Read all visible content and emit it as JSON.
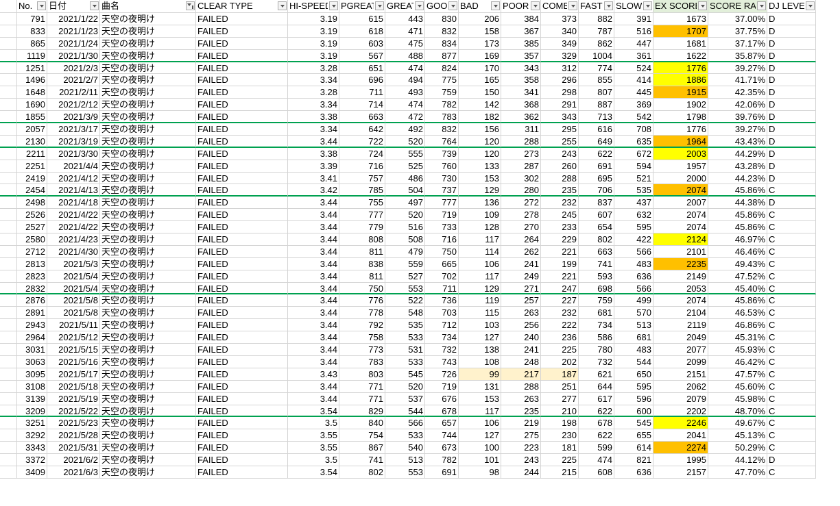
{
  "headers": [
    {
      "label": "",
      "filter": false
    },
    {
      "label": "No.",
      "filter": true
    },
    {
      "label": "日付",
      "filter": true
    },
    {
      "label": "曲名",
      "filter": true,
      "filtered": true
    },
    {
      "label": "CLEAR TYPE",
      "filter": true
    },
    {
      "label": "HI-SPEED",
      "filter": true
    },
    {
      "label": "PGREAT",
      "filter": true
    },
    {
      "label": "GREAT",
      "filter": true
    },
    {
      "label": "GOOD",
      "filter": true
    },
    {
      "label": "BAD",
      "filter": true
    },
    {
      "label": "POOR",
      "filter": true
    },
    {
      "label": "COMBO",
      "filter": true
    },
    {
      "label": "FAST",
      "filter": true
    },
    {
      "label": "SLOW",
      "filter": true
    },
    {
      "label": "EX SCORE",
      "filter": true,
      "green": true
    },
    {
      "label": "SCORE RATE",
      "filter": true,
      "green": true
    },
    {
      "label": "DJ LEVEL",
      "filter": true
    }
  ],
  "rows": [
    {
      "no": "791",
      "date": "2021/1/22",
      "song": "天空の夜明け",
      "clear": "FAILED",
      "hs": "3.19",
      "pg": "615",
      "gr": "443",
      "gd": "830",
      "bd": "206",
      "pr": "384",
      "cb": "373",
      "fs": "882",
      "sl": "391",
      "ex": "1673",
      "rate": "37.00%",
      "dj": "D"
    },
    {
      "no": "833",
      "date": "2021/1/23",
      "song": "天空の夜明け",
      "clear": "FAILED",
      "hs": "3.19",
      "pg": "618",
      "gr": "471",
      "gd": "832",
      "bd": "158",
      "pr": "367",
      "cb": "340",
      "fs": "787",
      "sl": "516",
      "ex": "1707",
      "rate": "37.75%",
      "dj": "D",
      "exhl": "o"
    },
    {
      "no": "865",
      "date": "2021/1/24",
      "song": "天空の夜明け",
      "clear": "FAILED",
      "hs": "3.19",
      "pg": "603",
      "gr": "475",
      "gd": "834",
      "bd": "173",
      "pr": "385",
      "cb": "349",
      "fs": "862",
      "sl": "447",
      "ex": "1681",
      "rate": "37.17%",
      "dj": "D"
    },
    {
      "no": "1119",
      "date": "2021/1/30",
      "song": "天空の夜明け",
      "clear": "FAILED",
      "hs": "3.19",
      "pg": "567",
      "gr": "488",
      "gd": "877",
      "bd": "169",
      "pr": "357",
      "cb": "329",
      "fs": "1004",
      "sl": "361",
      "ex": "1622",
      "rate": "35.87%",
      "dj": "D",
      "sep": true
    },
    {
      "no": "1251",
      "date": "2021/2/3",
      "song": "天空の夜明け",
      "clear": "FAILED",
      "hs": "3.28",
      "pg": "651",
      "gr": "474",
      "gd": "824",
      "bd": "170",
      "pr": "343",
      "cb": "312",
      "fs": "774",
      "sl": "524",
      "ex": "1776",
      "rate": "39.27%",
      "dj": "D",
      "exhl": "y"
    },
    {
      "no": "1496",
      "date": "2021/2/7",
      "song": "天空の夜明け",
      "clear": "FAILED",
      "hs": "3.34",
      "pg": "696",
      "gr": "494",
      "gd": "775",
      "bd": "165",
      "pr": "358",
      "cb": "296",
      "fs": "855",
      "sl": "414",
      "ex": "1886",
      "rate": "41.71%",
      "dj": "D",
      "exhl": "y"
    },
    {
      "no": "1648",
      "date": "2021/2/11",
      "song": "天空の夜明け",
      "clear": "FAILED",
      "hs": "3.28",
      "pg": "711",
      "gr": "493",
      "gd": "759",
      "bd": "150",
      "pr": "341",
      "cb": "298",
      "fs": "807",
      "sl": "445",
      "ex": "1915",
      "rate": "42.35%",
      "dj": "D",
      "exhl": "o"
    },
    {
      "no": "1690",
      "date": "2021/2/12",
      "song": "天空の夜明け",
      "clear": "FAILED",
      "hs": "3.34",
      "pg": "714",
      "gr": "474",
      "gd": "782",
      "bd": "142",
      "pr": "368",
      "cb": "291",
      "fs": "887",
      "sl": "369",
      "ex": "1902",
      "rate": "42.06%",
      "dj": "D"
    },
    {
      "no": "1855",
      "date": "2021/3/9",
      "song": "天空の夜明け",
      "clear": "FAILED",
      "hs": "3.38",
      "pg": "663",
      "gr": "472",
      "gd": "783",
      "bd": "182",
      "pr": "362",
      "cb": "343",
      "fs": "713",
      "sl": "542",
      "ex": "1798",
      "rate": "39.76%",
      "dj": "D",
      "sep": true
    },
    {
      "no": "2057",
      "date": "2021/3/17",
      "song": "天空の夜明け",
      "clear": "FAILED",
      "hs": "3.34",
      "pg": "642",
      "gr": "492",
      "gd": "832",
      "bd": "156",
      "pr": "311",
      "cb": "295",
      "fs": "616",
      "sl": "708",
      "ex": "1776",
      "rate": "39.27%",
      "dj": "D"
    },
    {
      "no": "2130",
      "date": "2021/3/19",
      "song": "天空の夜明け",
      "clear": "FAILED",
      "hs": "3.44",
      "pg": "722",
      "gr": "520",
      "gd": "764",
      "bd": "120",
      "pr": "288",
      "cb": "255",
      "fs": "649",
      "sl": "635",
      "ex": "1964",
      "rate": "43.43%",
      "dj": "D",
      "exhl": "o",
      "sep": true
    },
    {
      "no": "2211",
      "date": "2021/3/30",
      "song": "天空の夜明け",
      "clear": "FAILED",
      "hs": "3.38",
      "pg": "724",
      "gr": "555",
      "gd": "739",
      "bd": "120",
      "pr": "273",
      "cb": "243",
      "fs": "622",
      "sl": "672",
      "ex": "2003",
      "rate": "44.29%",
      "dj": "D",
      "exhl": "y"
    },
    {
      "no": "2251",
      "date": "2021/4/4",
      "song": "天空の夜明け",
      "clear": "FAILED",
      "hs": "3.39",
      "pg": "716",
      "gr": "525",
      "gd": "760",
      "bd": "133",
      "pr": "287",
      "cb": "260",
      "fs": "691",
      "sl": "594",
      "ex": "1957",
      "rate": "43.28%",
      "dj": "D"
    },
    {
      "no": "2419",
      "date": "2021/4/12",
      "song": "天空の夜明け",
      "clear": "FAILED",
      "hs": "3.41",
      "pg": "757",
      "gr": "486",
      "gd": "730",
      "bd": "153",
      "pr": "302",
      "cb": "288",
      "fs": "695",
      "sl": "521",
      "ex": "2000",
      "rate": "44.23%",
      "dj": "D"
    },
    {
      "no": "2454",
      "date": "2021/4/13",
      "song": "天空の夜明け",
      "clear": "FAILED",
      "hs": "3.42",
      "pg": "785",
      "gr": "504",
      "gd": "737",
      "bd": "129",
      "pr": "280",
      "cb": "235",
      "fs": "706",
      "sl": "535",
      "ex": "2074",
      "rate": "45.86%",
      "dj": "C",
      "exhl": "o",
      "sep": true
    },
    {
      "no": "2498",
      "date": "2021/4/18",
      "song": "天空の夜明け",
      "clear": "FAILED",
      "hs": "3.44",
      "pg": "755",
      "gr": "497",
      "gd": "777",
      "bd": "136",
      "pr": "272",
      "cb": "232",
      "fs": "837",
      "sl": "437",
      "ex": "2007",
      "rate": "44.38%",
      "dj": "D"
    },
    {
      "no": "2526",
      "date": "2021/4/22",
      "song": "天空の夜明け",
      "clear": "FAILED",
      "hs": "3.44",
      "pg": "777",
      "gr": "520",
      "gd": "719",
      "bd": "109",
      "pr": "278",
      "cb": "245",
      "fs": "607",
      "sl": "632",
      "ex": "2074",
      "rate": "45.86%",
      "dj": "C"
    },
    {
      "no": "2527",
      "date": "2021/4/22",
      "song": "天空の夜明け",
      "clear": "FAILED",
      "hs": "3.44",
      "pg": "779",
      "gr": "516",
      "gd": "733",
      "bd": "128",
      "pr": "270",
      "cb": "233",
      "fs": "654",
      "sl": "595",
      "ex": "2074",
      "rate": "45.86%",
      "dj": "C"
    },
    {
      "no": "2580",
      "date": "2021/4/23",
      "song": "天空の夜明け",
      "clear": "FAILED",
      "hs": "3.44",
      "pg": "808",
      "gr": "508",
      "gd": "716",
      "bd": "117",
      "pr": "264",
      "cb": "229",
      "fs": "802",
      "sl": "422",
      "ex": "2124",
      "rate": "46.97%",
      "dj": "C",
      "exhl": "y"
    },
    {
      "no": "2712",
      "date": "2021/4/30",
      "song": "天空の夜明け",
      "clear": "FAILED",
      "hs": "3.44",
      "pg": "811",
      "gr": "479",
      "gd": "750",
      "bd": "114",
      "pr": "262",
      "cb": "221",
      "fs": "663",
      "sl": "566",
      "ex": "2101",
      "rate": "46.46%",
      "dj": "C"
    },
    {
      "no": "2813",
      "date": "2021/5/3",
      "song": "天空の夜明け",
      "clear": "FAILED",
      "hs": "3.44",
      "pg": "838",
      "gr": "559",
      "gd": "665",
      "bd": "106",
      "pr": "241",
      "cb": "199",
      "fs": "741",
      "sl": "483",
      "ex": "2235",
      "rate": "49.43%",
      "dj": "C",
      "exhl": "o"
    },
    {
      "no": "2823",
      "date": "2021/5/4",
      "song": "天空の夜明け",
      "clear": "FAILED",
      "hs": "3.44",
      "pg": "811",
      "gr": "527",
      "gd": "702",
      "bd": "117",
      "pr": "249",
      "cb": "221",
      "fs": "593",
      "sl": "636",
      "ex": "2149",
      "rate": "47.52%",
      "dj": "C"
    },
    {
      "no": "2832",
      "date": "2021/5/4",
      "song": "天空の夜明け",
      "clear": "FAILED",
      "hs": "3.44",
      "pg": "750",
      "gr": "553",
      "gd": "711",
      "bd": "129",
      "pr": "271",
      "cb": "247",
      "fs": "698",
      "sl": "566",
      "ex": "2053",
      "rate": "45.40%",
      "dj": "C",
      "sep": true
    },
    {
      "no": "2876",
      "date": "2021/5/8",
      "song": "天空の夜明け",
      "clear": "FAILED",
      "hs": "3.44",
      "pg": "776",
      "gr": "522",
      "gd": "736",
      "bd": "119",
      "pr": "257",
      "cb": "227",
      "fs": "759",
      "sl": "499",
      "ex": "2074",
      "rate": "45.86%",
      "dj": "C"
    },
    {
      "no": "2891",
      "date": "2021/5/8",
      "song": "天空の夜明け",
      "clear": "FAILED",
      "hs": "3.44",
      "pg": "778",
      "gr": "548",
      "gd": "703",
      "bd": "115",
      "pr": "263",
      "cb": "232",
      "fs": "681",
      "sl": "570",
      "ex": "2104",
      "rate": "46.53%",
      "dj": "C"
    },
    {
      "no": "2943",
      "date": "2021/5/11",
      "song": "天空の夜明け",
      "clear": "FAILED",
      "hs": "3.44",
      "pg": "792",
      "gr": "535",
      "gd": "712",
      "bd": "103",
      "pr": "256",
      "cb": "222",
      "fs": "734",
      "sl": "513",
      "ex": "2119",
      "rate": "46.86%",
      "dj": "C"
    },
    {
      "no": "2964",
      "date": "2021/5/12",
      "song": "天空の夜明け",
      "clear": "FAILED",
      "hs": "3.44",
      "pg": "758",
      "gr": "533",
      "gd": "734",
      "bd": "127",
      "pr": "240",
      "cb": "236",
      "fs": "586",
      "sl": "681",
      "ex": "2049",
      "rate": "45.31%",
      "dj": "C"
    },
    {
      "no": "3031",
      "date": "2021/5/15",
      "song": "天空の夜明け",
      "clear": "FAILED",
      "hs": "3.44",
      "pg": "773",
      "gr": "531",
      "gd": "732",
      "bd": "138",
      "pr": "241",
      "cb": "225",
      "fs": "780",
      "sl": "483",
      "ex": "2077",
      "rate": "45.93%",
      "dj": "C"
    },
    {
      "no": "3063",
      "date": "2021/5/16",
      "song": "天空の夜明け",
      "clear": "FAILED",
      "hs": "3.44",
      "pg": "783",
      "gr": "533",
      "gd": "743",
      "bd": "108",
      "pr": "248",
      "cb": "202",
      "fs": "732",
      "sl": "544",
      "ex": "2099",
      "rate": "46.42%",
      "dj": "C"
    },
    {
      "no": "3095",
      "date": "2021/5/17",
      "song": "天空の夜明け",
      "clear": "FAILED",
      "hs": "3.43",
      "pg": "803",
      "gr": "545",
      "gd": "726",
      "bd": "99",
      "pr": "217",
      "cb": "187",
      "fs": "621",
      "sl": "650",
      "ex": "2151",
      "rate": "47.57%",
      "dj": "C",
      "missbest": true
    },
    {
      "no": "3108",
      "date": "2021/5/18",
      "song": "天空の夜明け",
      "clear": "FAILED",
      "hs": "3.44",
      "pg": "771",
      "gr": "520",
      "gd": "719",
      "bd": "131",
      "pr": "288",
      "cb": "251",
      "fs": "644",
      "sl": "595",
      "ex": "2062",
      "rate": "45.60%",
      "dj": "C"
    },
    {
      "no": "3139",
      "date": "2021/5/19",
      "song": "天空の夜明け",
      "clear": "FAILED",
      "hs": "3.44",
      "pg": "771",
      "gr": "537",
      "gd": "676",
      "bd": "153",
      "pr": "263",
      "cb": "277",
      "fs": "617",
      "sl": "596",
      "ex": "2079",
      "rate": "45.98%",
      "dj": "C"
    },
    {
      "no": "3209",
      "date": "2021/5/22",
      "song": "天空の夜明け",
      "clear": "FAILED",
      "hs": "3.54",
      "pg": "829",
      "gr": "544",
      "gd": "678",
      "bd": "117",
      "pr": "235",
      "cb": "210",
      "fs": "622",
      "sl": "600",
      "ex": "2202",
      "rate": "48.70%",
      "dj": "C",
      "sep": true
    },
    {
      "no": "3251",
      "date": "2021/5/23",
      "song": "天空の夜明け",
      "clear": "FAILED",
      "hs": "3.5",
      "pg": "840",
      "gr": "566",
      "gd": "657",
      "bd": "106",
      "pr": "219",
      "cb": "198",
      "fs": "678",
      "sl": "545",
      "ex": "2246",
      "rate": "49.67%",
      "dj": "C",
      "exhl": "y"
    },
    {
      "no": "3292",
      "date": "2021/5/28",
      "song": "天空の夜明け",
      "clear": "FAILED",
      "hs": "3.55",
      "pg": "754",
      "gr": "533",
      "gd": "744",
      "bd": "127",
      "pr": "275",
      "cb": "230",
      "fs": "622",
      "sl": "655",
      "ex": "2041",
      "rate": "45.13%",
      "dj": "C"
    },
    {
      "no": "3343",
      "date": "2021/5/31",
      "song": "天空の夜明け",
      "clear": "FAILED",
      "hs": "3.55",
      "pg": "867",
      "gr": "540",
      "gd": "673",
      "bd": "100",
      "pr": "223",
      "cb": "181",
      "fs": "599",
      "sl": "614",
      "ex": "2274",
      "rate": "50.29%",
      "dj": "C",
      "exhl": "o"
    },
    {
      "no": "3372",
      "date": "2021/6/2",
      "song": "天空の夜明け",
      "clear": "FAILED",
      "hs": "3.5",
      "pg": "741",
      "gr": "513",
      "gd": "782",
      "bd": "101",
      "pr": "243",
      "cb": "225",
      "fs": "474",
      "sl": "821",
      "ex": "1995",
      "rate": "44.12%",
      "dj": "D"
    },
    {
      "no": "3409",
      "date": "2021/6/3",
      "song": "天空の夜明け",
      "clear": "FAILED",
      "hs": "3.54",
      "pg": "802",
      "gr": "553",
      "gd": "691",
      "bd": "98",
      "pr": "244",
      "cb": "215",
      "fs": "608",
      "sl": "636",
      "ex": "2157",
      "rate": "47.70%",
      "dj": "C"
    }
  ],
  "colors": {
    "grid": "#d4d4d4",
    "separator": "#00a150",
    "header_green": "#e2efda",
    "highlight_yellow": "#ffff00",
    "highlight_orange": "#ffc000",
    "highlight_pale": "#fff2cc"
  }
}
